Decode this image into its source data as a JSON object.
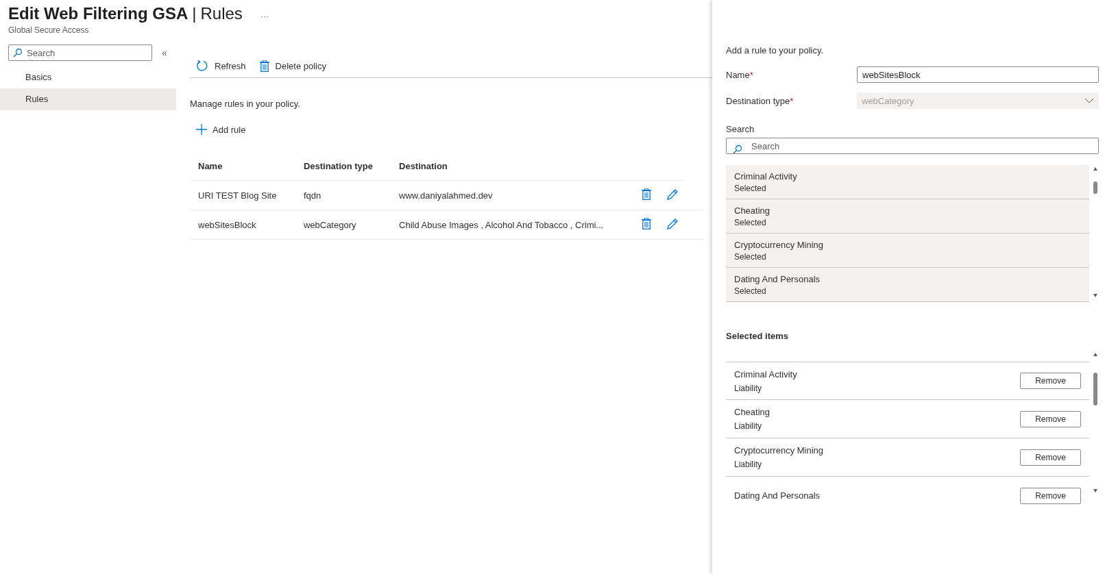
{
  "header": {
    "title": "Edit Web Filtering GSA",
    "separator": "|",
    "section": "Rules",
    "more": "···",
    "subtitle": "Global Secure Access"
  },
  "sidebar": {
    "search_placeholder": "Search",
    "collapse": "«",
    "items": [
      {
        "label": "Basics",
        "selected": false
      },
      {
        "label": "Rules",
        "selected": true
      }
    ]
  },
  "toolbar": [
    {
      "kind": "refresh",
      "label": "Refresh"
    },
    {
      "kind": "delete",
      "label": "Delete policy"
    }
  ],
  "description": "Manage rules in your policy.",
  "add_rule": "Add rule",
  "table": {
    "columns": [
      "Name",
      "Destination type",
      "Destination"
    ],
    "rows": [
      {
        "name": "URI TEST Blog Site",
        "type": "fqdn",
        "destination": "www.daniyalahmed.dev"
      },
      {
        "name": "webSitesBlock",
        "type": "webCategory",
        "destination": "Child Abuse Images , Alcohol And Tobacco , Crimi..."
      }
    ]
  },
  "panel": {
    "intro": "Add a rule to your policy.",
    "name_label": "Name",
    "name_value": "webSitesBlock",
    "type_label": "Destination type",
    "type_value": "webCategory",
    "type_disabled": true,
    "required_mark": "*",
    "search_label": "Search",
    "search_placeholder": "Search",
    "categories": [
      {
        "name": "Criminal Activity",
        "status": "Selected"
      },
      {
        "name": "Cheating",
        "status": "Selected"
      },
      {
        "name": "Cryptocurrency Mining",
        "status": "Selected"
      },
      {
        "name": "Dating And Personals",
        "status": "Selected"
      }
    ],
    "selected_heading": "Selected items",
    "selected_items": [
      {
        "name": "Criminal Activity",
        "group": "Liability",
        "action": "Remove"
      },
      {
        "name": "Cheating",
        "group": "Liability",
        "action": "Remove"
      },
      {
        "name": "Cryptocurrency Mining",
        "group": "Liability",
        "action": "Remove"
      },
      {
        "name": "Dating And Personals",
        "action": "Remove"
      }
    ]
  }
}
